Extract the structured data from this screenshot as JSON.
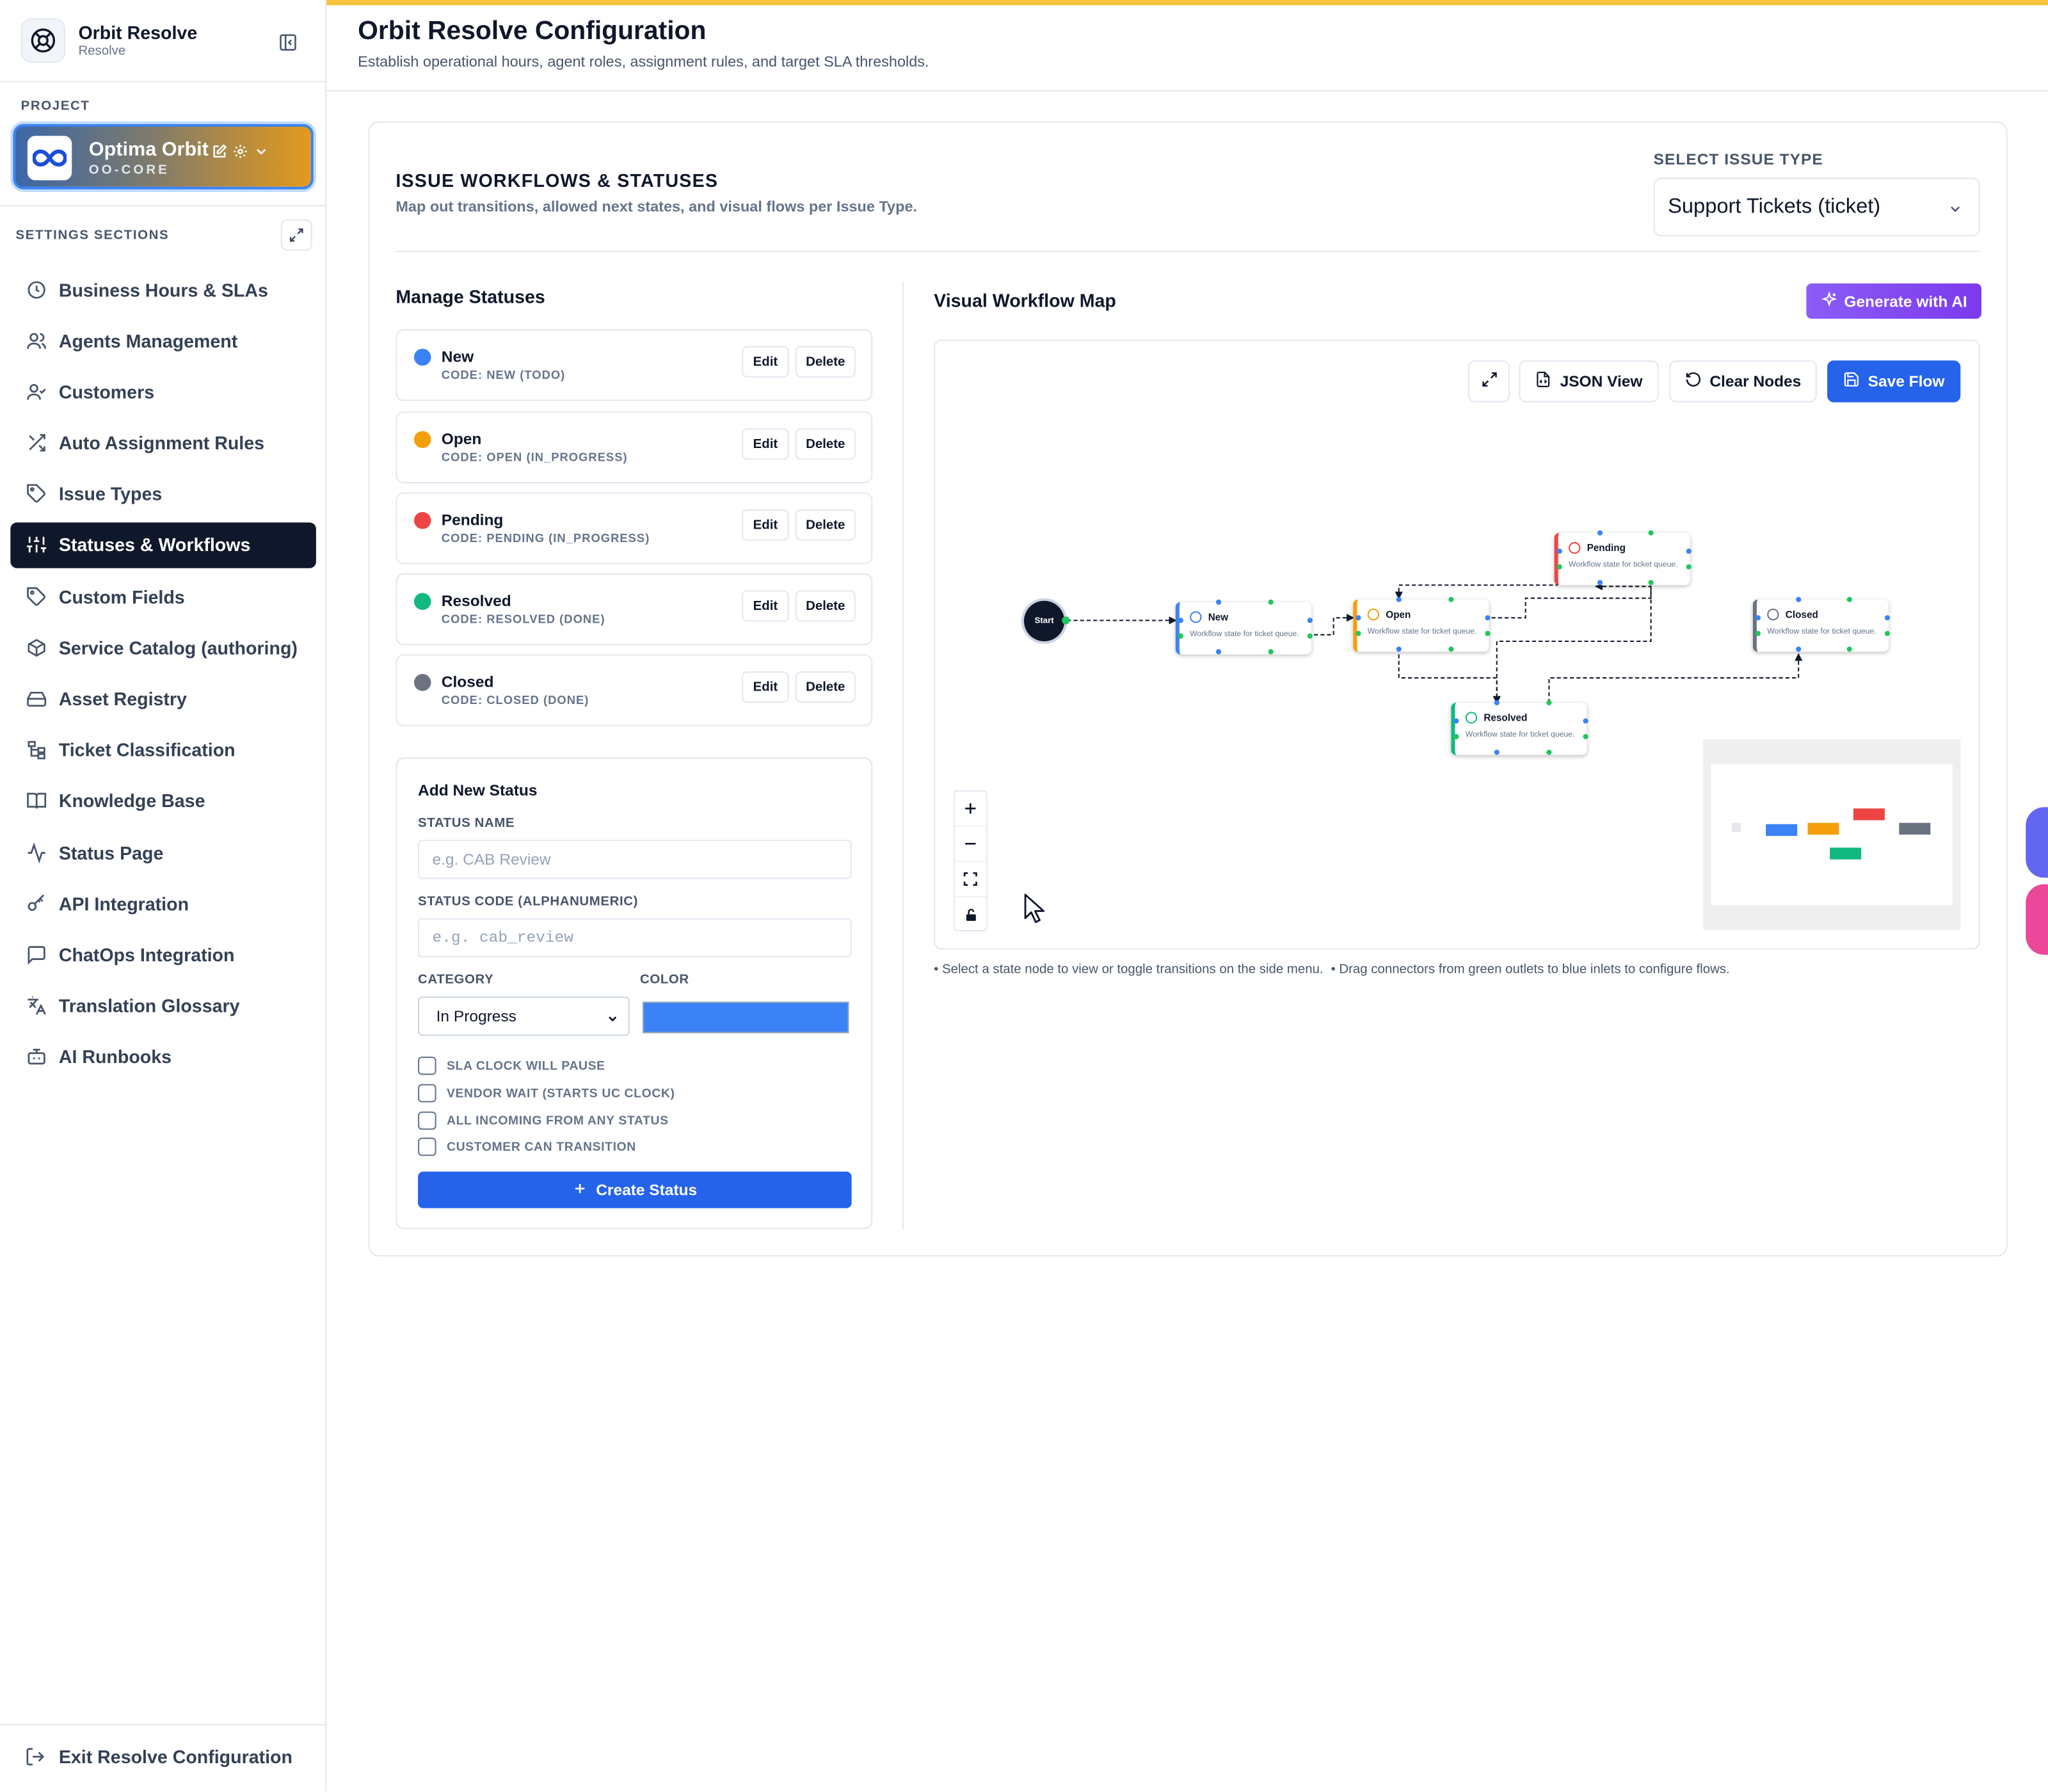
{
  "app": {
    "name": "Orbit Resolve",
    "sub": "Resolve"
  },
  "project": {
    "section_label": "PROJECT",
    "name": "Optima Orbit",
    "code": "OO-CORE"
  },
  "sidebar": {
    "section_label": "SETTINGS SECTIONS",
    "items": [
      {
        "label": "Business Hours & SLAs",
        "icon": "clock-icon"
      },
      {
        "label": "Agents Management",
        "icon": "users-icon"
      },
      {
        "label": "Customers",
        "icon": "user-check-icon"
      },
      {
        "label": "Auto Assignment Rules",
        "icon": "shuffle-icon"
      },
      {
        "label": "Issue Types",
        "icon": "tag-icon"
      },
      {
        "label": "Statuses & Workflows",
        "icon": "sliders-icon",
        "active": true
      },
      {
        "label": "Custom Fields",
        "icon": "tag-icon"
      },
      {
        "label": "Service Catalog (authoring)",
        "icon": "package-icon"
      },
      {
        "label": "Asset Registry",
        "icon": "hard-drive-icon"
      },
      {
        "label": "Ticket Classification",
        "icon": "hierarchy-icon"
      },
      {
        "label": "Knowledge Base",
        "icon": "book-icon"
      },
      {
        "label": "Status Page",
        "icon": "activity-icon"
      },
      {
        "label": "API Integration",
        "icon": "key-icon"
      },
      {
        "label": "ChatOps Integration",
        "icon": "message-icon"
      },
      {
        "label": "Translation Glossary",
        "icon": "languages-icon"
      },
      {
        "label": "AI Runbooks",
        "icon": "bot-icon"
      }
    ],
    "exit_label": "Exit Resolve Configuration"
  },
  "header": {
    "title": "Orbit Resolve Configuration",
    "subtitle": "Establish operational hours, agent roles, assignment rules, and target SLA thresholds."
  },
  "workflows": {
    "title": "ISSUE WORKFLOWS & STATUSES",
    "subtitle": "Map out transitions, allowed next states, and visual flows per Issue Type.",
    "issue_type_label": "SELECT ISSUE TYPE",
    "issue_type_value": "Support Tickets (ticket)"
  },
  "manage": {
    "title": "Manage Statuses",
    "edit_label": "Edit",
    "delete_label": "Delete",
    "statuses": [
      {
        "name": "New",
        "code": "CODE: NEW (TODO)",
        "color": "#3b82f6"
      },
      {
        "name": "Open",
        "code": "CODE: OPEN (IN_PROGRESS)",
        "color": "#f59e0b"
      },
      {
        "name": "Pending",
        "code": "CODE: PENDING (IN_PROGRESS)",
        "color": "#ef4444"
      },
      {
        "name": "Resolved",
        "code": "CODE: RESOLVED (DONE)",
        "color": "#10b981"
      },
      {
        "name": "Closed",
        "code": "CODE: CLOSED (DONE)",
        "color": "#6b7280"
      }
    ]
  },
  "add_status": {
    "title": "Add New Status",
    "name_label": "STATUS NAME",
    "name_placeholder": "e.g. CAB Review",
    "code_label": "STATUS CODE (ALPHANUMERIC)",
    "code_placeholder": "e.g. cab_review",
    "category_label": "CATEGORY",
    "category_value": "In Progress",
    "color_label": "COLOR",
    "color_value": "#3b82f6",
    "checkboxes": [
      "SLA CLOCK WILL PAUSE",
      "VENDOR WAIT (STARTS UC CLOCK)",
      "ALL INCOMING FROM ANY STATUS",
      "CUSTOMER CAN TRANSITION"
    ],
    "create_label": "Create Status"
  },
  "map": {
    "title": "Visual Workflow Map",
    "generate_label": "Generate with AI",
    "json_view_label": "JSON View",
    "clear_label": "Clear Nodes",
    "save_label": "Save Flow",
    "start_label": "Start",
    "node_desc": "Workflow state for ticket queue.",
    "notes": [
      "• Select a state node to view or toggle transitions on the side menu.",
      "• Drag connectors from green outlets to blue inlets to configure flows."
    ]
  }
}
